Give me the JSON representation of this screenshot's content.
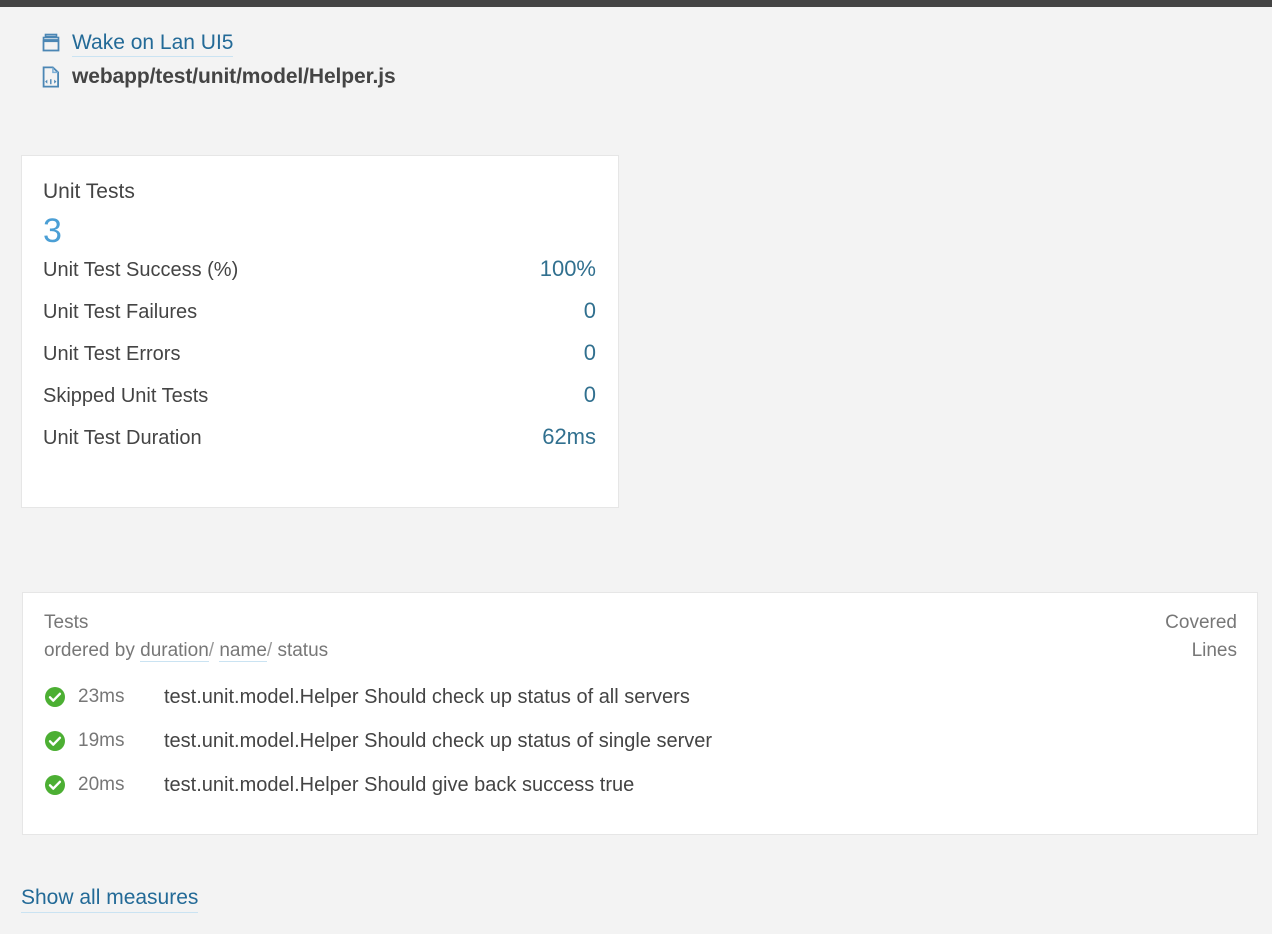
{
  "breadcrumb": {
    "project": {
      "icon": "drawer-icon",
      "label": "Wake on Lan UI5"
    },
    "file": {
      "icon": "code-file-icon",
      "label": "webapp/test/unit/model/Helper.js"
    }
  },
  "measures_card": {
    "title": "Unit Tests",
    "big_value": "3",
    "rows": [
      {
        "name": "Unit Test Success (%)",
        "value": "100%"
      },
      {
        "name": "Unit Test Failures",
        "value": "0"
      },
      {
        "name": "Unit Test Errors",
        "value": "0"
      },
      {
        "name": "Skipped Unit Tests",
        "value": "0"
      },
      {
        "name": "Unit Test Duration",
        "value": "62ms"
      }
    ]
  },
  "tests_panel": {
    "title": "Tests",
    "ordered_by_prefix": "ordered by",
    "sort_duration": "duration",
    "sort_name": "name",
    "sort_status": "status",
    "separator": "/",
    "covered_header_line1": "Covered",
    "covered_header_line2": "Lines",
    "rows": [
      {
        "status": "ok",
        "status_icon": "check-circle-icon",
        "duration": "23ms",
        "name": "test.unit.model.Helper Should check up status of all servers",
        "covered_lines": ""
      },
      {
        "status": "ok",
        "status_icon": "check-circle-icon",
        "duration": "19ms",
        "name": "test.unit.model.Helper Should check up status of single server",
        "covered_lines": ""
      },
      {
        "status": "ok",
        "status_icon": "check-circle-icon",
        "duration": "20ms",
        "name": "test.unit.model.Helper Should give back success true",
        "covered_lines": ""
      }
    ]
  },
  "footer": {
    "show_all_measures": "Show all measures"
  },
  "colors": {
    "link": "#236a97",
    "value": "#31708f",
    "big_value": "#4b9fd5",
    "muted": "#777777",
    "text": "#444444",
    "success": "#4caf33",
    "page_bg": "#f3f3f3",
    "panel_bg": "#ffffff",
    "panel_border": "#e6e6e6",
    "top_strip": "#444444"
  }
}
